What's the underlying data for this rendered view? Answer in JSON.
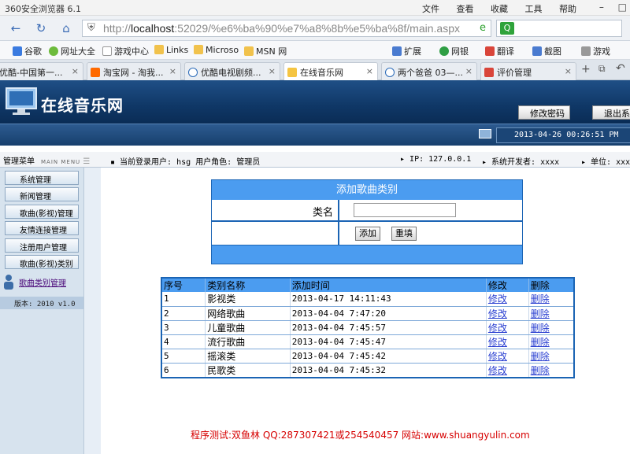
{
  "browser": {
    "title": "360安全浏览器 6.1",
    "menus": [
      "文件",
      "查看",
      "收藏",
      "工具",
      "帮助"
    ],
    "url_host": "localhost",
    "url_rest": ":52029/%e6%ba%90%e7%a8%8b%e5%ba%8f/main.aspx",
    "favorites": [
      "谷歌",
      "网址大全",
      "游戏中心",
      "Links",
      "Microso",
      "MSN 网"
    ],
    "toolbar_right": [
      "扩展",
      "网银",
      "翻译",
      "截图",
      "游戏"
    ],
    "tabs": [
      "优酷-中国第一...",
      "淘宝网 - 淘我...",
      "优酷电视剧频...",
      "在线音乐网",
      "两个爸爸 03—...",
      "评价管理"
    ],
    "active_tab": 3
  },
  "header": {
    "site_title": "在线音乐网",
    "change_password": "修改密码",
    "logout": "退出系",
    "datetime": "2013-04-26 00:26:51 PM"
  },
  "infobar": {
    "menu_title": "管理菜单",
    "menu_sub": "MAIN MENU",
    "current_user": "当前登录用户: hsg",
    "user_role": "用户角色: 管理员",
    "ip": "IP: 127.0.0.1",
    "developer": "系统开发者: xxxx",
    "unit": "单位: xxxx"
  },
  "sidebar": {
    "items": [
      "系统管理",
      "新闻管理",
      "歌曲(影视)管理",
      "友情连接管理",
      "注册用户管理",
      "歌曲(影视)类别"
    ],
    "current": "歌曲类别管理",
    "version": "版本: 2010 v1.0"
  },
  "add_form": {
    "title": "添加歌曲类别",
    "field_label": "类名",
    "field_value": "",
    "add_button": "添加",
    "reset_button": "重填"
  },
  "category_table": {
    "columns": [
      "序号",
      "类别名称",
      "添加时间",
      "修改",
      "删除"
    ],
    "rows": [
      {
        "id": "1",
        "name": "影视类",
        "time": "2013-04-17 14:11:43",
        "edit": "修改",
        "delete": "删除"
      },
      {
        "id": "2",
        "name": "网络歌曲",
        "time": "2013-04-04 7:47:20",
        "edit": "修改",
        "delete": "删除"
      },
      {
        "id": "3",
        "name": "儿童歌曲",
        "time": "2013-04-04 7:45:57",
        "edit": "修改",
        "delete": "删除"
      },
      {
        "id": "4",
        "name": "流行歌曲",
        "time": "2013-04-04 7:45:47",
        "edit": "修改",
        "delete": "删除"
      },
      {
        "id": "5",
        "name": "摇滚类",
        "time": "2013-04-04 7:45:42",
        "edit": "修改",
        "delete": "删除"
      },
      {
        "id": "6",
        "name": "民歌类",
        "time": "2013-04-04 7:45:32",
        "edit": "修改",
        "delete": "删除"
      }
    ]
  },
  "footer": "程序测试:双鱼林 QQ:287307421或254540457 网站:www.shuangyulin.com",
  "colors": {
    "accent": "#4b9cf0",
    "border": "#1b64b4",
    "header_bg": "#0f3766",
    "footer_text": "#d60000"
  }
}
